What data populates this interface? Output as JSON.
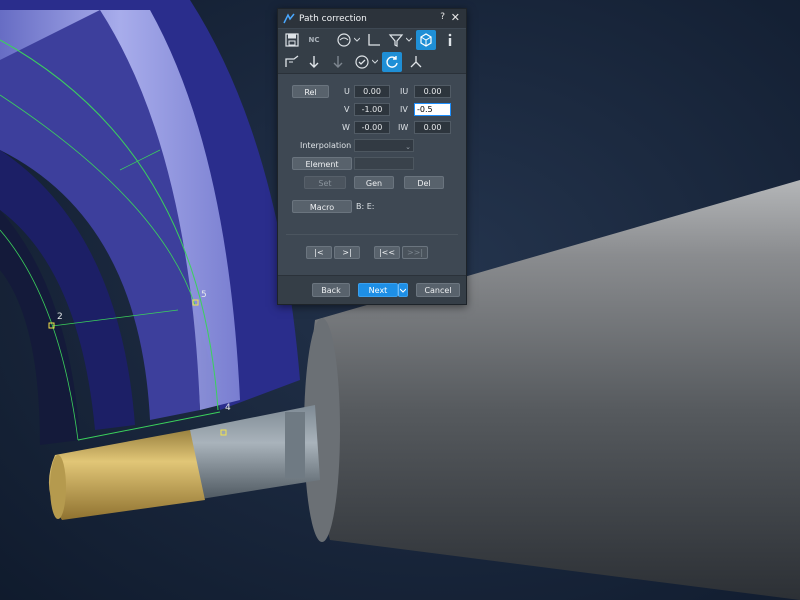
{
  "dialog": {
    "title": "Path correction",
    "help": "?",
    "close": "✕",
    "toolbar_row1": [
      "save-icon",
      "nc-icon",
      "view-icon",
      "axis-icon",
      "filter-icon",
      "cube-icon",
      "info-icon"
    ],
    "toolbar_row2": [
      "tool-icon",
      "arrow-down-icon",
      "arrow-down-gray-icon",
      "check-icon",
      "refresh-icon",
      "triad-icon"
    ],
    "nc_label": "NC",
    "rel_button": "Rel",
    "fields": {
      "u_label": "U",
      "u_value": "0.00",
      "iu_label": "IU",
      "iu_value": "0.00",
      "v_label": "V",
      "v_value": "-1.00",
      "iv_label": "IV",
      "iv_value": "-0.5",
      "w_label": "W",
      "w_value": "-0.00",
      "iw_label": "IW",
      "iw_value": "0.00"
    },
    "interpolation_label": "Interpolation",
    "element_button": "Element",
    "set_button": "Set",
    "gen_button": "Gen",
    "del_button": "Del",
    "macro_button": "Macro",
    "macro_info": "B: E:",
    "nav": {
      "first": "|<",
      "next_step": ">|",
      "rewind": "|<<",
      "end": ">>|"
    },
    "footer": {
      "back": "Back",
      "next": "Next",
      "cancel": "Cancel"
    }
  },
  "viewport": {
    "markers": [
      "2",
      "5",
      "4"
    ],
    "colors": {
      "background": "#14233a",
      "ring": "#2c2e8c",
      "groove": "#8c92dd",
      "gold": "#c8a84e",
      "steel": "#6b7177",
      "accent": "#1e8fe6"
    }
  }
}
